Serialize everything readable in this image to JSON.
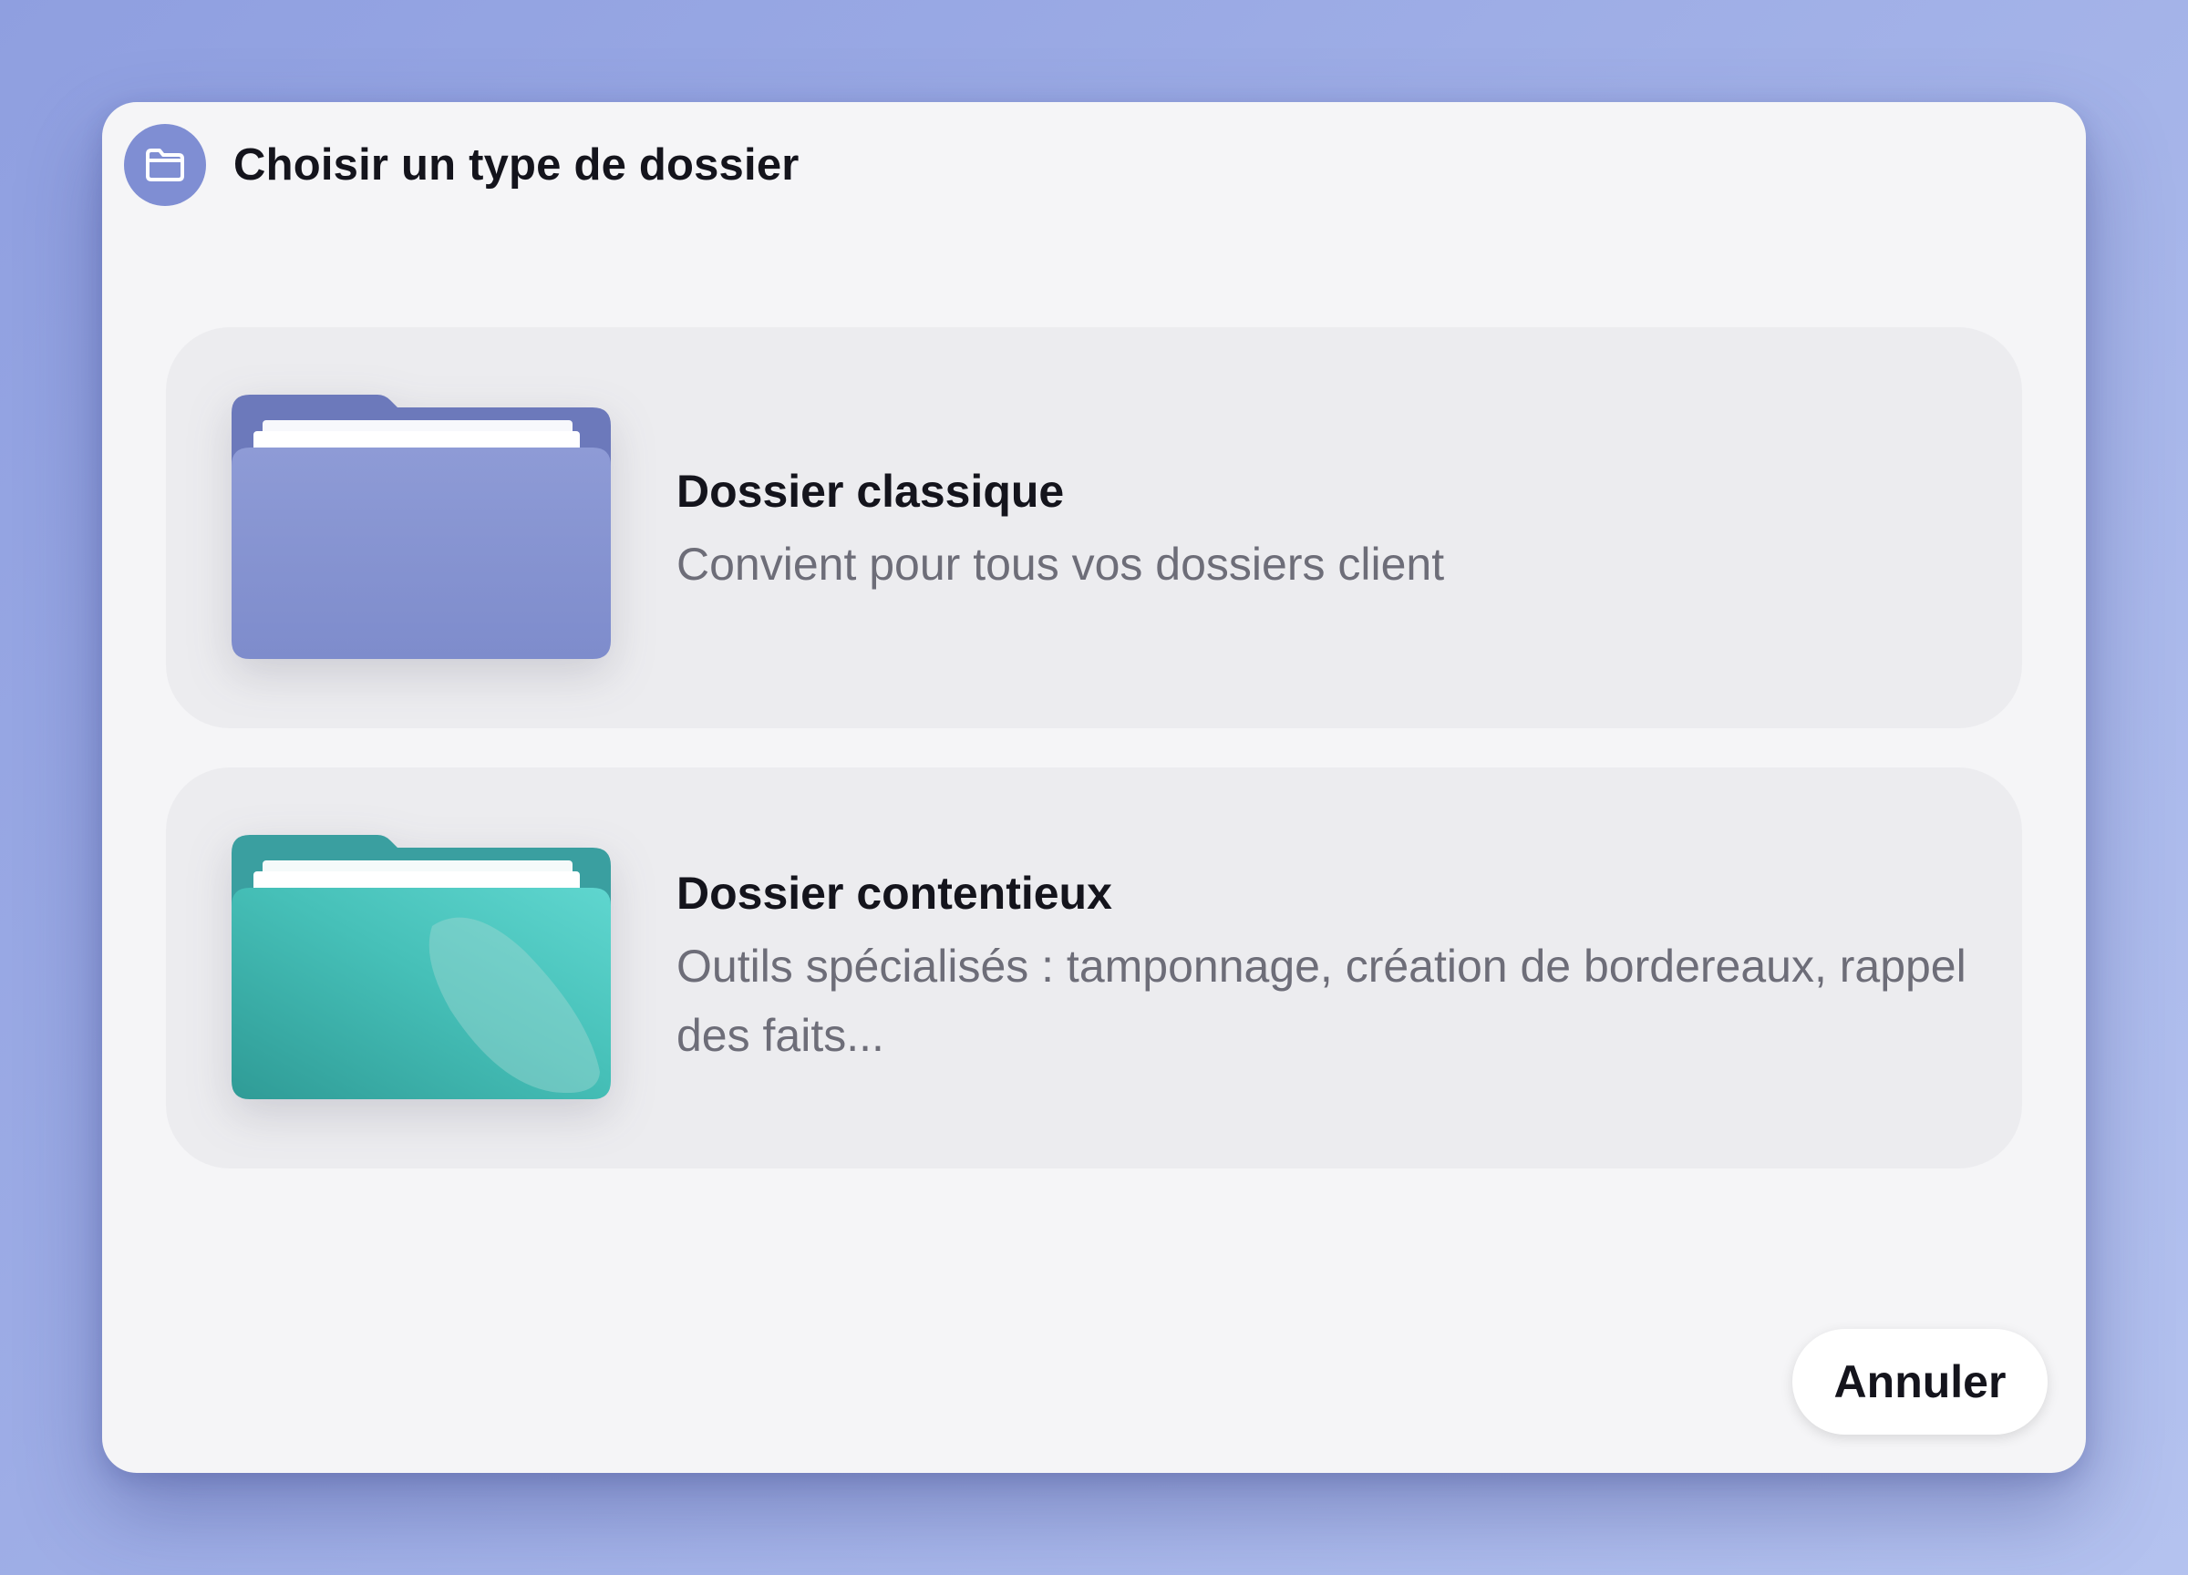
{
  "dialog": {
    "title": "Choisir un type de dossier",
    "header_icon": "folder-icon"
  },
  "options": [
    {
      "title": "Dossier classique",
      "description": "Convient pour tous vos dossiers client",
      "icon": "folder-classic-icon",
      "color": "#8896d2"
    },
    {
      "title": "Dossier contentieux",
      "description": "Outils spécialisés : tamponnage, création de bordereaux, rappel des faits...",
      "icon": "folder-litigation-icon",
      "color": "#4fcbc4"
    }
  ],
  "actions": {
    "cancel_label": "Annuler"
  },
  "colors": {
    "accent": "#7f8ed3",
    "dialog_background": "#f5f5f7",
    "option_background": "#ececef"
  }
}
